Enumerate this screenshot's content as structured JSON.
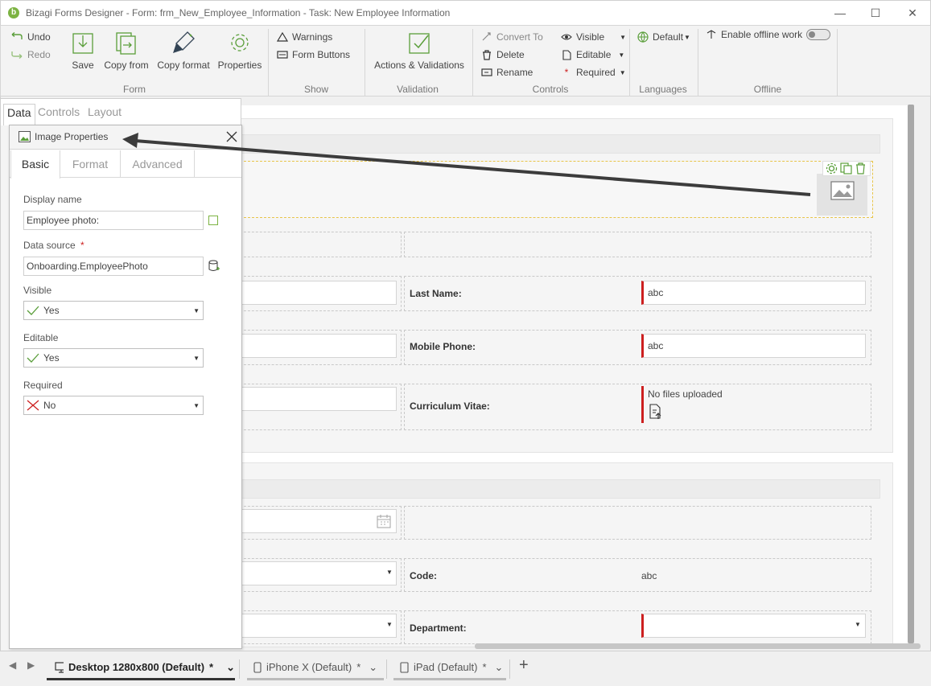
{
  "window": {
    "title": "Bizagi Forms Designer  - Form: frm_New_Employee_Information - Task:  New Employee Information",
    "logo_letter": "b",
    "minimize": "—",
    "maximize": "☐",
    "close": "✕"
  },
  "ribbon": {
    "undo": "Undo",
    "redo": "Redo",
    "save": "Save",
    "copy_from": "Copy from",
    "copy_format": "Copy format",
    "properties": "Properties",
    "group_form": "Form",
    "warnings": "Warnings",
    "form_buttons": "Form Buttons",
    "group_show": "Show",
    "actions_validations": "Actions & Validations",
    "group_validation": "Validation",
    "convert_to": "Convert To",
    "delete": "Delete",
    "rename": "Rename",
    "visible": "Visible",
    "editable": "Editable",
    "required": "Required",
    "group_controls": "Controls",
    "language_default": "Default",
    "group_languages": "Languages",
    "enable_offline": "Enable offline work",
    "group_offline": "Offline"
  },
  "side_tabs": [
    "Data",
    "Controls",
    "Layout"
  ],
  "properties_panel": {
    "title": "Image Properties",
    "tabs": [
      "Basic",
      "Format",
      "Advanced"
    ],
    "display_name_label": "Display name",
    "display_name_value": "Employee photo:",
    "data_source_label": "Data source",
    "data_source_required_mark": "*",
    "data_source_value": "Onboarding.EmployeePhoto",
    "visible_label": "Visible",
    "visible_value": "Yes",
    "editable_label": "Editable",
    "editable_value": "Yes",
    "required_label": "Required",
    "required_value": "No"
  },
  "form": {
    "last_name_label": "Last Name:",
    "last_name_value": "abc",
    "mobile_phone_label": "Mobile Phone:",
    "mobile_phone_value": "abc",
    "cv_label": "Curriculum Vitae:",
    "cv_value": "No files uploaded",
    "code_label": "Code:",
    "code_value": "abc",
    "department_label": "Department:"
  },
  "bottom_tabs": [
    {
      "label": "Desktop 1280x800 (Default)",
      "modified": "*",
      "active": true
    },
    {
      "label": "iPhone X (Default)",
      "modified": "*",
      "active": false
    },
    {
      "label": "iPad (Default)",
      "modified": "*",
      "active": false
    }
  ],
  "add_tab": "+",
  "colors": {
    "accent_green": "#7cb342",
    "required_red": "#cc1f1f",
    "selection_yellow": "#e8c54a"
  }
}
